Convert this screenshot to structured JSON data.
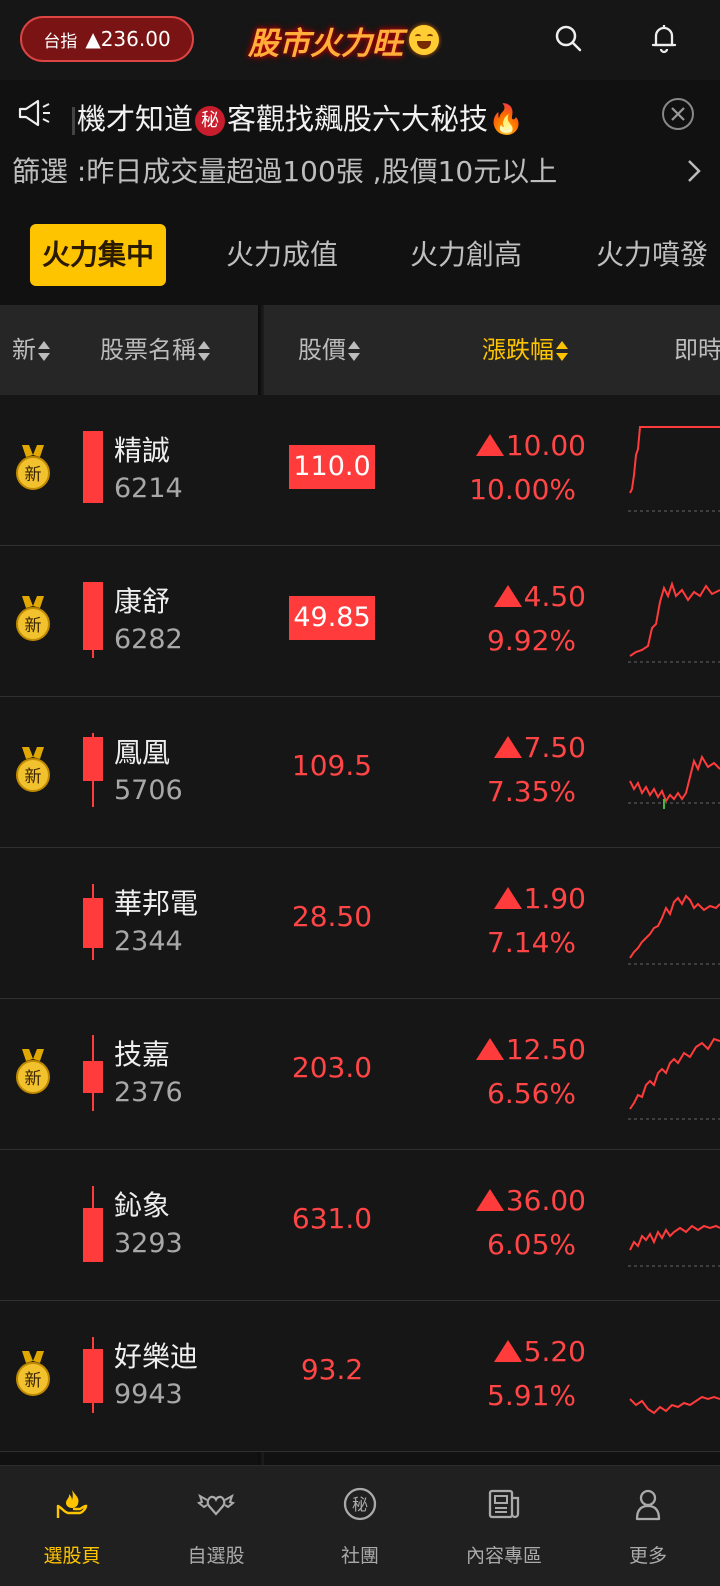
{
  "header": {
    "index_label": "台指",
    "index_value": "▲236.00",
    "app_title": "股市火力旺"
  },
  "announcement": {
    "text_before": "機才知道",
    "badge": "秘",
    "text_after": "客觀找飆股六大秘技🔥"
  },
  "filter_text": "篩選 :昨日成交量超過100張 ,股價10元以上",
  "tabs": [
    {
      "label": "火力集中",
      "active": true
    },
    {
      "label": "火力成值",
      "active": false
    },
    {
      "label": "火力創高",
      "active": false
    },
    {
      "label": "火力噴發",
      "active": false
    }
  ],
  "columns": {
    "new": "新",
    "name": "股票名稱",
    "price": "股價",
    "change": "漲跌幅",
    "realtime": "即時"
  },
  "new_badge": "新",
  "stocks": [
    {
      "name": "精誠",
      "code": "6214",
      "price": "110.0",
      "change": "10.00",
      "pct": "10.00%",
      "new": true,
      "price_highlight": true
    },
    {
      "name": "康舒",
      "code": "6282",
      "price": "49.85",
      "change": "4.50",
      "pct": "9.92%",
      "new": true,
      "price_highlight": true
    },
    {
      "name": "鳳凰",
      "code": "5706",
      "price": "109.5",
      "change": "7.50",
      "pct": "7.35%",
      "new": true,
      "price_highlight": false
    },
    {
      "name": "華邦電",
      "code": "2344",
      "price": "28.50",
      "change": "1.90",
      "pct": "7.14%",
      "new": false,
      "price_highlight": false
    },
    {
      "name": "技嘉",
      "code": "2376",
      "price": "203.0",
      "change": "12.50",
      "pct": "6.56%",
      "new": true,
      "price_highlight": false
    },
    {
      "name": "鈊象",
      "code": "3293",
      "price": "631.0",
      "change": "36.00",
      "pct": "6.05%",
      "new": false,
      "price_highlight": false
    },
    {
      "name": "好樂迪",
      "code": "9943",
      "price": "93.2",
      "change": "5.20",
      "pct": "5.91%",
      "new": true,
      "price_highlight": false
    }
  ],
  "bottom_nav": [
    {
      "label": "選股頁",
      "icon": "fire-hand-icon",
      "active": true
    },
    {
      "label": "自選股",
      "icon": "winged-heart-icon",
      "active": false
    },
    {
      "label": "社團",
      "icon": "secret-circle-icon",
      "active": false
    },
    {
      "label": "內容專區",
      "icon": "newspaper-icon",
      "active": false
    },
    {
      "label": "更多",
      "icon": "person-icon",
      "active": false
    }
  ],
  "colors": {
    "accent": "#ffc400",
    "up": "#ff3b3b",
    "background": "#111111"
  }
}
